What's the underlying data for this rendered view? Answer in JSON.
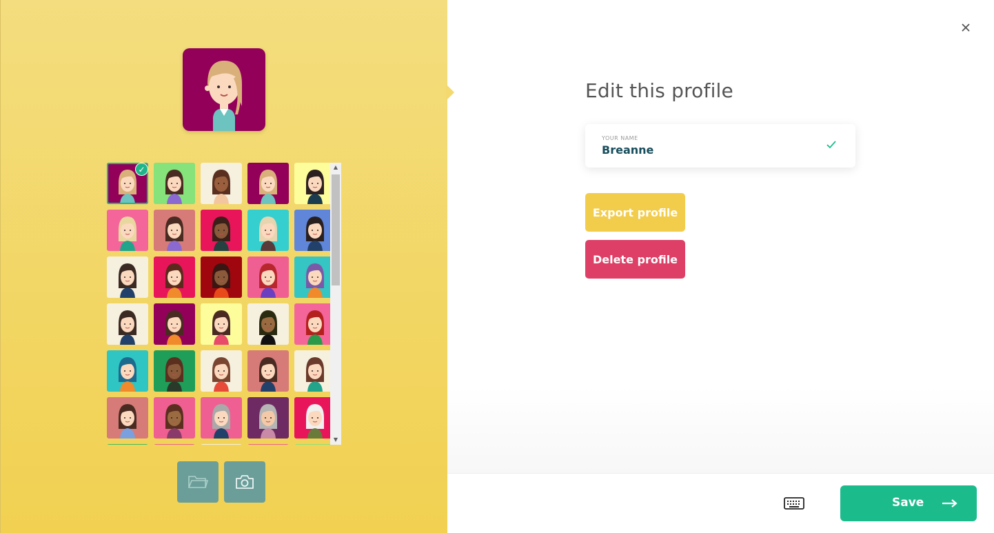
{
  "dialog": {
    "title": "Edit this profile",
    "close_icon": "close-icon"
  },
  "name_field": {
    "label": "YOUR NAME",
    "value": "Breanne",
    "valid_icon": "check-icon"
  },
  "actions": {
    "export_label": "Export profile",
    "delete_label": "Delete profile"
  },
  "footer": {
    "keyboard_icon": "keyboard-icon",
    "save_label": "Save",
    "save_arrow_icon": "arrow-right-icon"
  },
  "avatar_picker": {
    "selected_index": 0,
    "tools": [
      "folder-icon",
      "camera-icon"
    ],
    "tile_colors": [
      "#93005a",
      "#86e27a",
      "#f6f0df",
      "#93005a",
      "#fdfd9c",
      "#f4669a",
      "#d67b78",
      "#e8155b",
      "#35cfcf",
      "#5f86d9",
      "#f6f0df",
      "#e8155b",
      "#a0060e",
      "#ef5f91",
      "#35c5c2",
      "#f6f0df",
      "#93005a",
      "#fdfd9c",
      "#f6f0df",
      "#f4669a",
      "#2fc5c3",
      "#1f9e59",
      "#f6f0df",
      "#d67b78",
      "#f6f0df",
      "#d67b78",
      "#ef5f91",
      "#ef5f91",
      "#6e2b63",
      "#e8155b"
    ],
    "partial_row_colors": [
      "#3fbd5f",
      "#ef5f91",
      "#f6f0df",
      "#ef5f91",
      "#86e27a"
    ]
  },
  "colors": {
    "accent_green": "#1cbb8c",
    "export_yellow": "#f2cc4b",
    "delete_red": "#de3f67",
    "panel_yellow": "#f2d151"
  }
}
